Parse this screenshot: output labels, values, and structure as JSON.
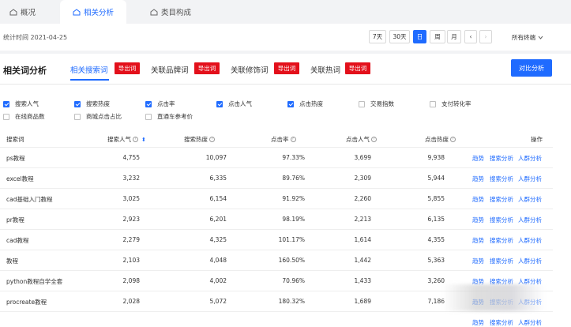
{
  "top_tabs": [
    {
      "label": "概况",
      "icon": "home-icon"
    },
    {
      "label": "相关分析",
      "icon": "home-icon",
      "active": true
    },
    {
      "label": "类目构成",
      "icon": "home-icon"
    }
  ],
  "stats": {
    "time_label": "统计时间 2021-04-25",
    "ranges": [
      "7天",
      "30天",
      "日",
      "周",
      "月"
    ],
    "active_range": "日",
    "prev": "‹",
    "next": "›",
    "terminal": "所有终端"
  },
  "panel": {
    "title": "相关词分析",
    "subtabs": [
      "相关搜索词",
      "关联品牌词",
      "关联修饰词",
      "关联热词"
    ],
    "export_label": "导出词",
    "compare_label": "对比分析"
  },
  "metrics": [
    {
      "label": "搜索人气",
      "checked": true
    },
    {
      "label": "搜索热度",
      "checked": true
    },
    {
      "label": "点击率",
      "checked": true
    },
    {
      "label": "点击人气",
      "checked": true
    },
    {
      "label": "点击热度",
      "checked": true
    },
    {
      "label": "交易指数",
      "checked": false
    },
    {
      "label": "支付转化率",
      "checked": false
    },
    {
      "label": "在线商品数",
      "checked": false
    },
    {
      "label": "商城点击占比",
      "checked": false
    },
    {
      "label": "直通车参考价",
      "checked": false
    }
  ],
  "table": {
    "headers": [
      "搜索词",
      "搜索人气",
      "搜索热度",
      "点击率",
      "点击人气",
      "点击热度",
      "操作"
    ],
    "help_mark": "?",
    "sort_mark": "⬍",
    "actions": [
      "趋势",
      "搜索分析",
      "人群分析"
    ],
    "rows": [
      [
        "ps教程",
        "4,755",
        "10,097",
        "97.33%",
        "3,699",
        "9,938"
      ],
      [
        "excel教程",
        "3,232",
        "6,335",
        "89.76%",
        "2,309",
        "5,944"
      ],
      [
        "cad基础入门教程",
        "3,025",
        "6,154",
        "91.92%",
        "2,260",
        "5,855"
      ],
      [
        "pr教程",
        "2,923",
        "6,201",
        "98.19%",
        "2,213",
        "6,135"
      ],
      [
        "cad教程",
        "2,279",
        "4,325",
        "101.17%",
        "1,614",
        "4,355"
      ],
      [
        "教程",
        "2,103",
        "4,048",
        "160.50%",
        "1,442",
        "5,363"
      ],
      [
        "python教程自学全套",
        "2,098",
        "4,002",
        "70.96%",
        "1,433",
        "3,260"
      ],
      [
        "procreate教程",
        "2,028",
        "5,072",
        "180.32%",
        "1,689",
        "7,186"
      ],
      [
        "",
        "",
        "",
        "",
        "",
        ""
      ]
    ]
  },
  "colors": {
    "accent": "#1f6bff",
    "export": "#e3101b"
  }
}
